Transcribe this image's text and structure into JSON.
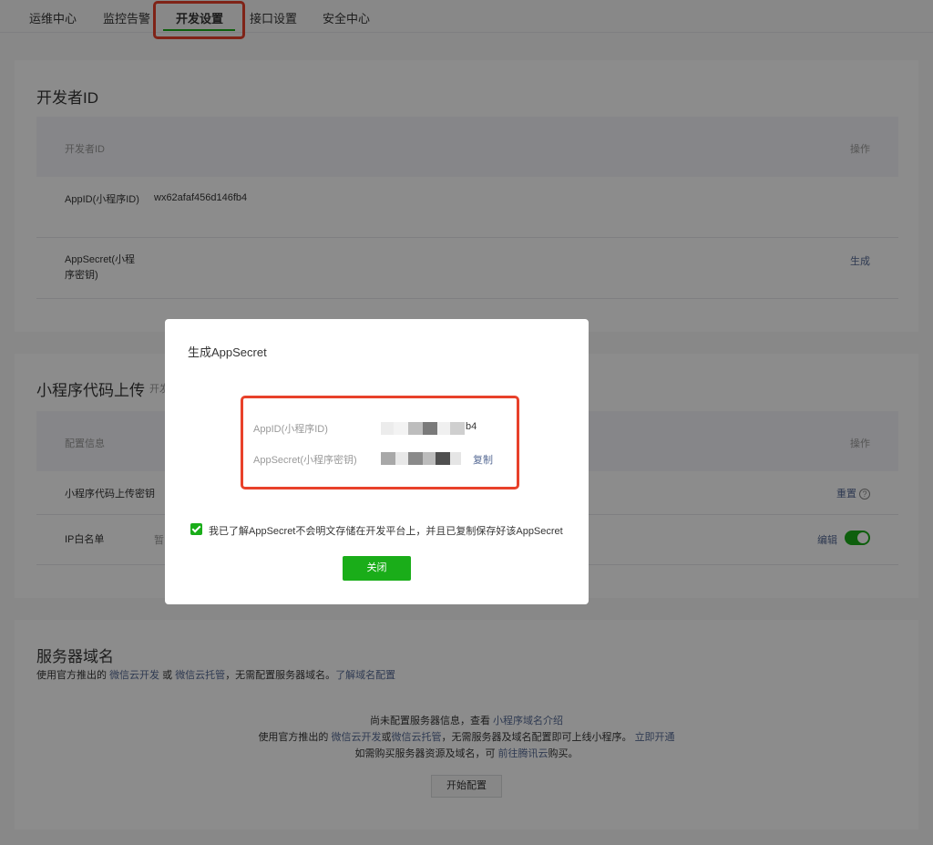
{
  "tabs": [
    "运维中心",
    "监控告警",
    "开发设置",
    "接口设置",
    "安全中心"
  ],
  "devid": {
    "title": "开发者ID",
    "col_header": "开发者ID",
    "col_action": "操作",
    "appid_label": "AppID(小程序ID)",
    "appid_value": "wx62afaf456d146fb4",
    "secret_label": "AppSecret(小程序密钥)",
    "secret_action": "生成"
  },
  "upload": {
    "title": "小程序代码上传",
    "subtitle": "开发",
    "col_header": "配置信息",
    "col_action": "操作",
    "key_label": "小程序代码上传密钥",
    "key_action": "重置",
    "ip_label": "IP白名单",
    "ip_value": "暂",
    "ip_action": "编辑"
  },
  "server": {
    "title": "服务器域名",
    "desc_prefix": "使用官方推出的 ",
    "desc_link1": "微信云开发",
    "desc_or": " 或 ",
    "desc_link2": "微信云托管",
    "desc_mid": "，无需配置服务器域名。",
    "desc_link3": "了解域名配置",
    "line1_prefix": "尚未配置服务器信息，查看 ",
    "line1_link": "小程序域名介绍",
    "line2_prefix": "使用官方推出的 ",
    "line2_link1": "微信云开发",
    "line2_or": "或",
    "line2_link2": "微信云托管",
    "line2_mid": "，无需服务器及域名配置即可上线小程序。 ",
    "line2_link3": "立即开通",
    "line3_prefix": "如需购买服务器资源及域名，可 ",
    "line3_link": "前往腾讯云",
    "line3_suffix": "购买。",
    "start_btn": "开始配置"
  },
  "modal": {
    "title": "生成AppSecret",
    "appid_label": "AppID(小程序ID)",
    "appid_tail": "b4",
    "secret_label": "AppSecret(小程序密钥)",
    "copy": "复制",
    "checkbox_text": "我已了解AppSecret不会明文存储在开发平台上，并且已复制保存好该AppSecret",
    "close": "关闭"
  },
  "colors": {
    "accent": "#1aad19",
    "link": "#576b95",
    "highlight": "#e8412a"
  },
  "icons": [
    "help-icon",
    "check-icon",
    "toggle-switch"
  ]
}
